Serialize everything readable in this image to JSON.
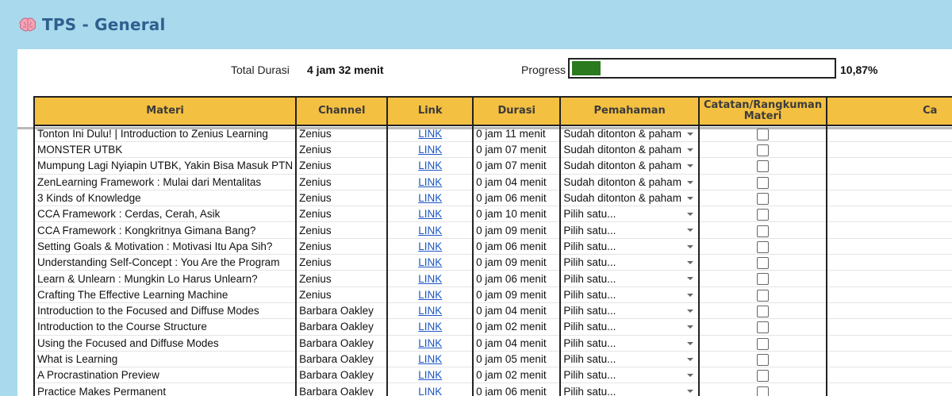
{
  "page": {
    "title": "TPS - General",
    "title_icon": "brain-icon"
  },
  "summary": {
    "total_label": "Total Durasi",
    "total_value": "4 jam 32 menit",
    "progress_label": "Progress",
    "progress_fraction": 0.1087,
    "progress_text": "10,87%"
  },
  "colors": {
    "header": "#f4c041",
    "progress": "#2b7a1e",
    "link": "#1a56c4",
    "background": "#a8d9ec",
    "title": "#2f5f8e"
  },
  "table": {
    "headers": [
      "Materi",
      "Channel",
      "Link",
      "Durasi",
      "Pemahaman",
      "Catatan/Rangkuman Materi",
      "Ca"
    ],
    "rows": [
      {
        "materi": "Tonton Ini Dulu! | Introduction to Zenius Learning",
        "channel": "Zenius",
        "link": "LINK",
        "durasi": "0 jam 11 menit",
        "pemahaman": "Sudah ditonton & paham",
        "catatan": false
      },
      {
        "materi": "MONSTER UTBK",
        "channel": "Zenius",
        "link": "LINK",
        "durasi": "0 jam 07 menit",
        "pemahaman": "Sudah ditonton & paham",
        "catatan": false
      },
      {
        "materi": "Mumpung Lagi Nyiapin UTBK, Yakin Bisa Masuk PTN",
        "channel": "Zenius",
        "link": "LINK",
        "durasi": "0 jam 07 menit",
        "pemahaman": "Sudah ditonton & paham",
        "catatan": false
      },
      {
        "materi": "ZenLearning Framework : Mulai dari Mentalitas",
        "channel": "Zenius",
        "link": "LINK",
        "durasi": "0 jam 04 menit",
        "pemahaman": "Sudah ditonton & paham",
        "catatan": false
      },
      {
        "materi": "3 Kinds of Knowledge",
        "channel": "Zenius",
        "link": "LINK",
        "durasi": "0 jam 06 menit",
        "pemahaman": "Sudah ditonton & paham",
        "catatan": false
      },
      {
        "materi": "CCA Framework : Cerdas, Cerah, Asik",
        "channel": "Zenius",
        "link": "LINK",
        "durasi": "0 jam 10 menit",
        "pemahaman": "Pilih satu...",
        "catatan": false
      },
      {
        "materi": "CCA Framework : Kongkritnya Gimana Bang?",
        "channel": "Zenius",
        "link": "LINK",
        "durasi": "0 jam 09 menit",
        "pemahaman": "Pilih satu...",
        "catatan": false
      },
      {
        "materi": "Setting Goals & Motivation : Motivasi Itu Apa Sih?",
        "channel": "Zenius",
        "link": "LINK",
        "durasi": "0 jam 06 menit",
        "pemahaman": "Pilih satu...",
        "catatan": false
      },
      {
        "materi": "Understanding Self-Concept : You Are the Program",
        "channel": "Zenius",
        "link": "LINK",
        "durasi": "0 jam 09 menit",
        "pemahaman": "Pilih satu...",
        "catatan": false
      },
      {
        "materi": "Learn & Unlearn : Mungkin Lo Harus Unlearn?",
        "channel": "Zenius",
        "link": "LINK",
        "durasi": "0 jam 06 menit",
        "pemahaman": "Pilih satu...",
        "catatan": false
      },
      {
        "materi": "Crafting The Effective Learning Machine",
        "channel": "Zenius",
        "link": "LINK",
        "durasi": "0 jam 09 menit",
        "pemahaman": "Pilih satu...",
        "catatan": false
      },
      {
        "materi": "Introduction to the Focused and Diffuse Modes",
        "channel": "Barbara Oakley",
        "link": "LINK",
        "durasi": "0 jam 04 menit",
        "pemahaman": "Pilih satu...",
        "catatan": false
      },
      {
        "materi": "Introduction to the Course Structure",
        "channel": "Barbara Oakley",
        "link": "LINK",
        "durasi": "0 jam 02 menit",
        "pemahaman": "Pilih satu...",
        "catatan": false
      },
      {
        "materi": "Using the Focused and Diffuse Modes",
        "channel": "Barbara Oakley",
        "link": "LINK",
        "durasi": "0 jam 04 menit",
        "pemahaman": "Pilih satu...",
        "catatan": false
      },
      {
        "materi": "What is Learning",
        "channel": "Barbara Oakley",
        "link": "LINK",
        "durasi": "0 jam 05 menit",
        "pemahaman": "Pilih satu...",
        "catatan": false
      },
      {
        "materi": "A Procrastination Preview",
        "channel": "Barbara Oakley",
        "link": "LINK",
        "durasi": "0 jam 02 menit",
        "pemahaman": "Pilih satu...",
        "catatan": false
      },
      {
        "materi": "Practice Makes Permanent",
        "channel": "Barbara Oakley",
        "link": "LINK",
        "durasi": "0 jam 06 menit",
        "pemahaman": "Pilih satu...",
        "catatan": false
      }
    ]
  }
}
